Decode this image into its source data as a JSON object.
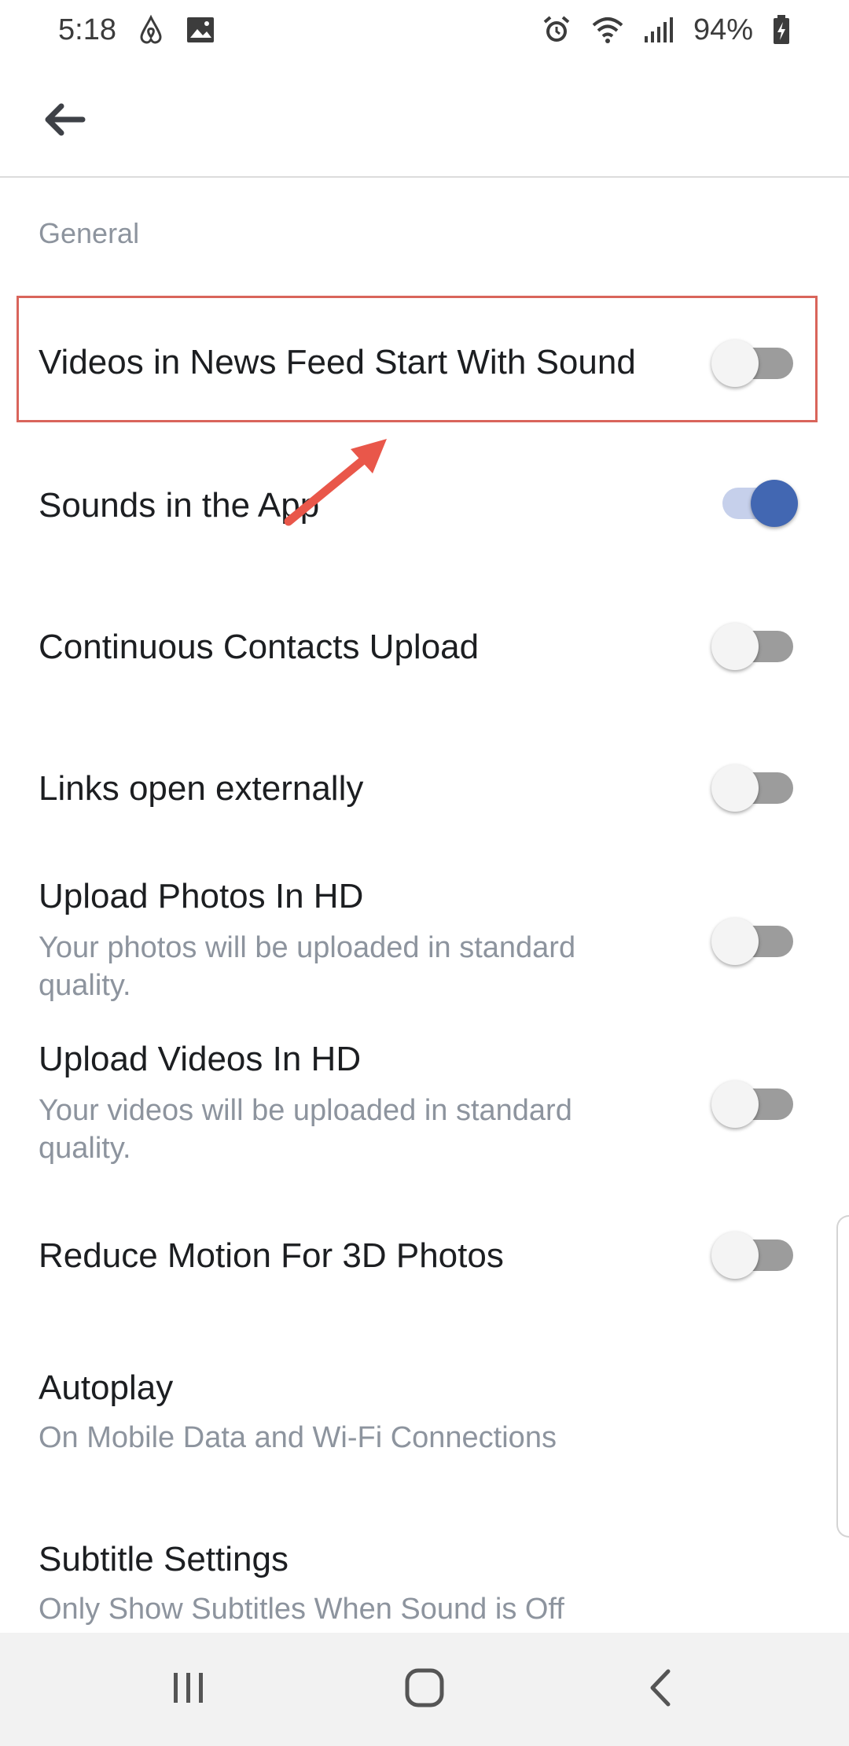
{
  "status_bar": {
    "time": "5:18",
    "left_icons": [
      "airbnb-icon",
      "gallery-icon"
    ],
    "right_icons": [
      "alarm-icon",
      "wifi-icon",
      "signal-icon",
      "battery-charging-icon"
    ],
    "battery_percent": "94%"
  },
  "app_bar": {
    "back_icon": "back-arrow-icon"
  },
  "section": {
    "title": "General"
  },
  "settings": [
    {
      "title": "Videos in News Feed Start With Sound",
      "enabled": false,
      "highlighted": true
    },
    {
      "title": "Sounds in the App",
      "enabled": true
    },
    {
      "title": "Continuous Contacts Upload",
      "enabled": false
    },
    {
      "title": "Links open externally",
      "enabled": false
    },
    {
      "title": "Upload Photos In HD",
      "subtitle": "Your photos will be uploaded in standard quality.",
      "enabled": false
    },
    {
      "title": "Upload Videos In HD",
      "subtitle": "Your videos will be uploaded in standard quality.",
      "enabled": false
    },
    {
      "title": "Reduce Motion For 3D Photos",
      "enabled": false
    },
    {
      "title": "Autoplay",
      "subtitle": "On Mobile Data and Wi-Fi Connections"
    },
    {
      "title": "Subtitle Settings",
      "subtitle": "Only Show Subtitles When Sound is Off"
    }
  ],
  "annotation": {
    "arrow_color": "#e9574a",
    "box_color": "#d9655b"
  },
  "colors": {
    "toggle_on": "#4267b2",
    "toggle_on_track": "#c6d0eb",
    "toggle_off_track": "#9c9c9c"
  },
  "nav_bar": {
    "icons": [
      "recent-apps-icon",
      "home-icon",
      "back-icon"
    ]
  }
}
